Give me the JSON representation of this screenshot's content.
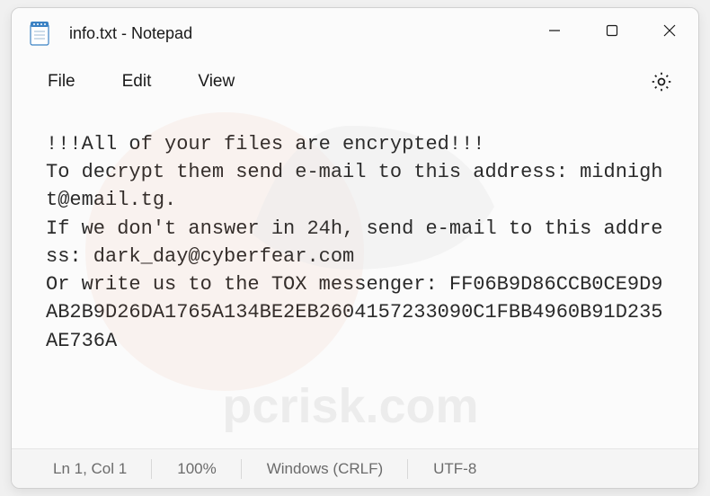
{
  "titlebar": {
    "title": "info.txt - Notepad"
  },
  "menu": {
    "file": "File",
    "edit": "Edit",
    "view": "View"
  },
  "content": {
    "text": "!!!All of your files are encrypted!!!\nTo decrypt them send e-mail to this address: midnight@email.tg.\nIf we don't answer in 24h, send e-mail to this address: dark_day@cyberfear.com\nOr write us to the TOX messenger: FF06B9D86CCB0CE9D9AB2B9D26DA1765A134BE2EB2604157233090C1FBB4960B91D235AE736A"
  },
  "statusbar": {
    "position": "Ln 1, Col 1",
    "zoom": "100%",
    "lineending": "Windows (CRLF)",
    "encoding": "UTF-8"
  },
  "watermark": {
    "text": "pcrisk.com"
  }
}
